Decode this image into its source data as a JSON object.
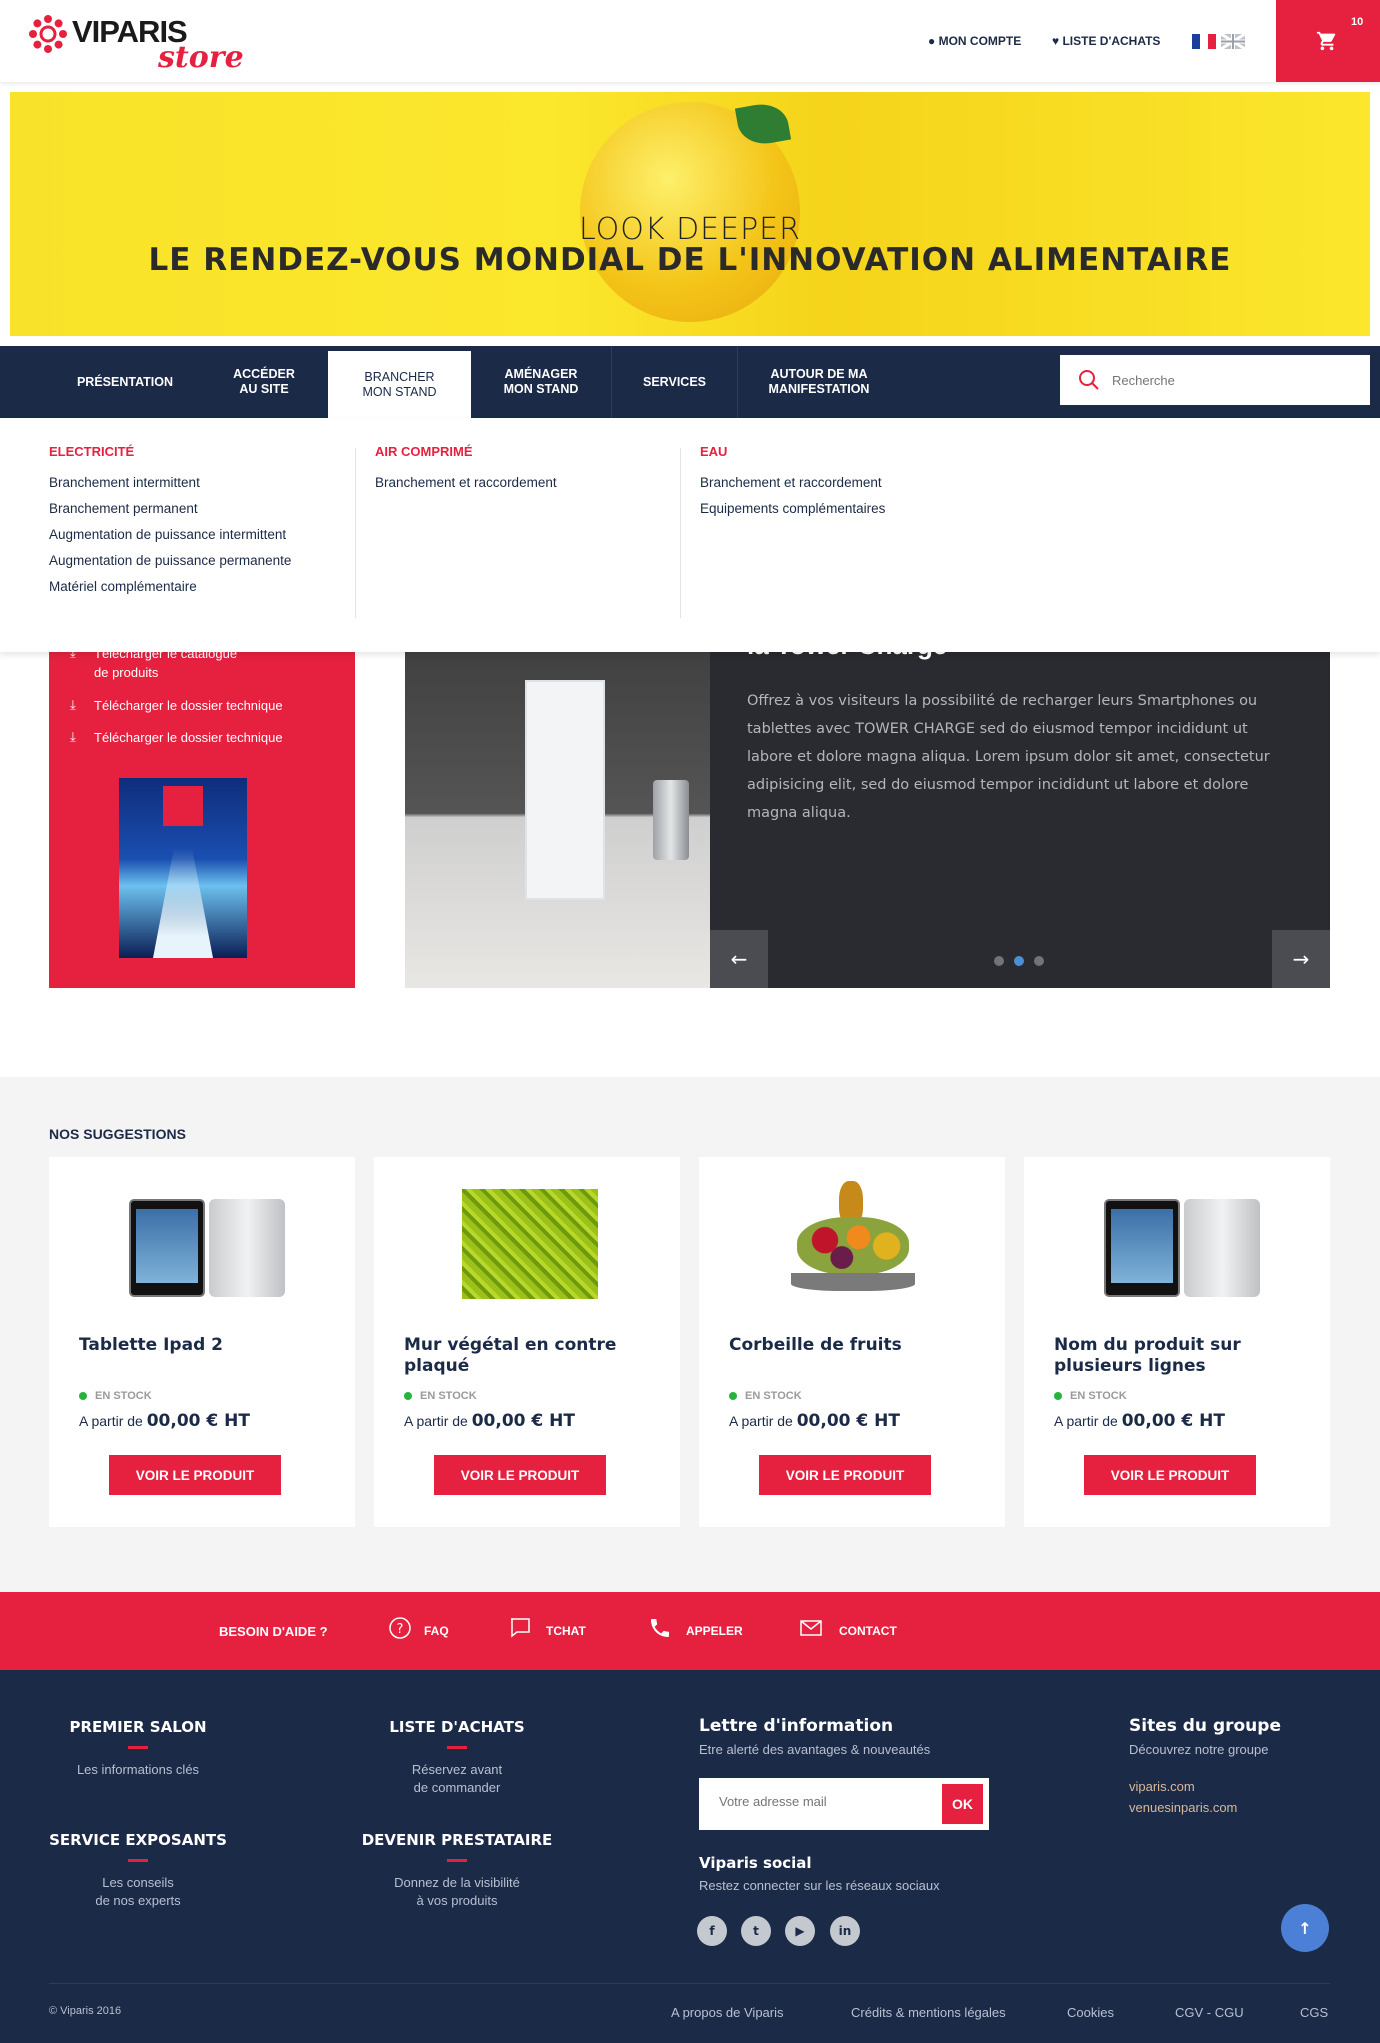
{
  "header": {
    "logo_viparis": "VIPARIS",
    "logo_store": "store",
    "account": "MON COMPTE",
    "wishlist": "LISTE D'ACHATS",
    "cart_count": "10"
  },
  "banner": {
    "small": "LOOK DEEPER",
    "big": "LE RENDEZ-VOUS MONDIAL DE L'INNOVATION ALIMENTAIRE"
  },
  "nav": {
    "items": [
      {
        "label": "PRÉSENTATION"
      },
      {
        "label": "ACCÉDER\nAU SITE"
      },
      {
        "label": "BRANCHER\nMON STAND"
      },
      {
        "label": "AMÉNAGER\nMON STAND"
      },
      {
        "label": "SERVICES"
      },
      {
        "label": "AUTOUR DE MA\nMANIFESTATION"
      }
    ],
    "search_placeholder": "Recherche"
  },
  "mega": {
    "cols": [
      {
        "title": "ELECTRICITÉ",
        "items": [
          "Branchement intermittent",
          "Branchement permanent",
          "Augmentation de puissance intermittent",
          "Augmentation de puissance permanente",
          "Matériel complémentaire"
        ]
      },
      {
        "title": "AIR COMPRIMÉ",
        "items": [
          "Branchement  et raccordement"
        ]
      },
      {
        "title": "EAU",
        "items": [
          "Branchement  et raccordement",
          "Equipements complémentaires"
        ]
      }
    ]
  },
  "docs": {
    "items": [
      "Télécharger le catalogue\nde produits",
      "Télécharger le dossier technique",
      "Télécharger le dossier technique"
    ]
  },
  "slide": {
    "title": "la Tower Charge",
    "body": "Offrez à vos visiteurs la possibilité de recharger leurs Smartphones ou tablettes avec TOWER CHARGE sed do eiusmod tempor incididunt ut labore et dolore magna aliqua. Lorem ipsum dolor sit amet, consectetur adipisicing elit, sed do eiusmod tempor incididunt ut labore et dolore magna aliqua.",
    "prev": "←",
    "next": "→"
  },
  "suggestions": {
    "title": "NOS SUGGESTIONS",
    "stock": "EN STOCK",
    "price_prefix": "A partir de ",
    "price": "00,00 € HT",
    "button": "VOIR LE PRODUIT",
    "products": [
      {
        "name": "Tablette Ipad 2"
      },
      {
        "name": "Mur végétal en contre plaqué"
      },
      {
        "name": "Corbeille de fruits"
      },
      {
        "name": "Nom du produit sur plusieurs lignes"
      }
    ]
  },
  "help": {
    "title": "BESOIN D'AIDE ?",
    "faq": "FAQ",
    "chat": "TCHAT",
    "call": "APPELER",
    "contact": "CONTACT"
  },
  "footer": {
    "c1": {
      "title": "PREMIER SALON",
      "text": "Les informations clés"
    },
    "c2": {
      "title": "LISTE D'ACHATS",
      "text": "Réservez avant\nde commander"
    },
    "c3": {
      "title": "SERVICE EXPOSANTS",
      "text": "Les conseils\nde nos experts"
    },
    "c4": {
      "title": "DEVENIR PRESTATAIRE",
      "text": "Donnez de la visibilité\nà vos produits"
    },
    "newsletter_title": "Lettre d'information",
    "newsletter_sub": "Etre alerté des avantages & nouveautés",
    "newsletter_placeholder": "Votre adresse mail",
    "newsletter_ok": "OK",
    "social_title": "Viparis social",
    "social_sub": "Restez connecter sur les réseaux sociaux",
    "group_title": "Sites du groupe",
    "group_sub": "Découvrez notre groupe",
    "group_links": [
      "viparis.com",
      "venuesinparis.com"
    ],
    "copyright": "© Viparis 2016",
    "bottom_links": [
      "A propos de Viparis",
      "Crédits & mentions légales",
      "Cookies",
      "CGV - CGU",
      "CGS"
    ]
  },
  "colors": {
    "accent": "#e5213f",
    "navy": "#1b2a47",
    "banner": "#fbe72c"
  }
}
